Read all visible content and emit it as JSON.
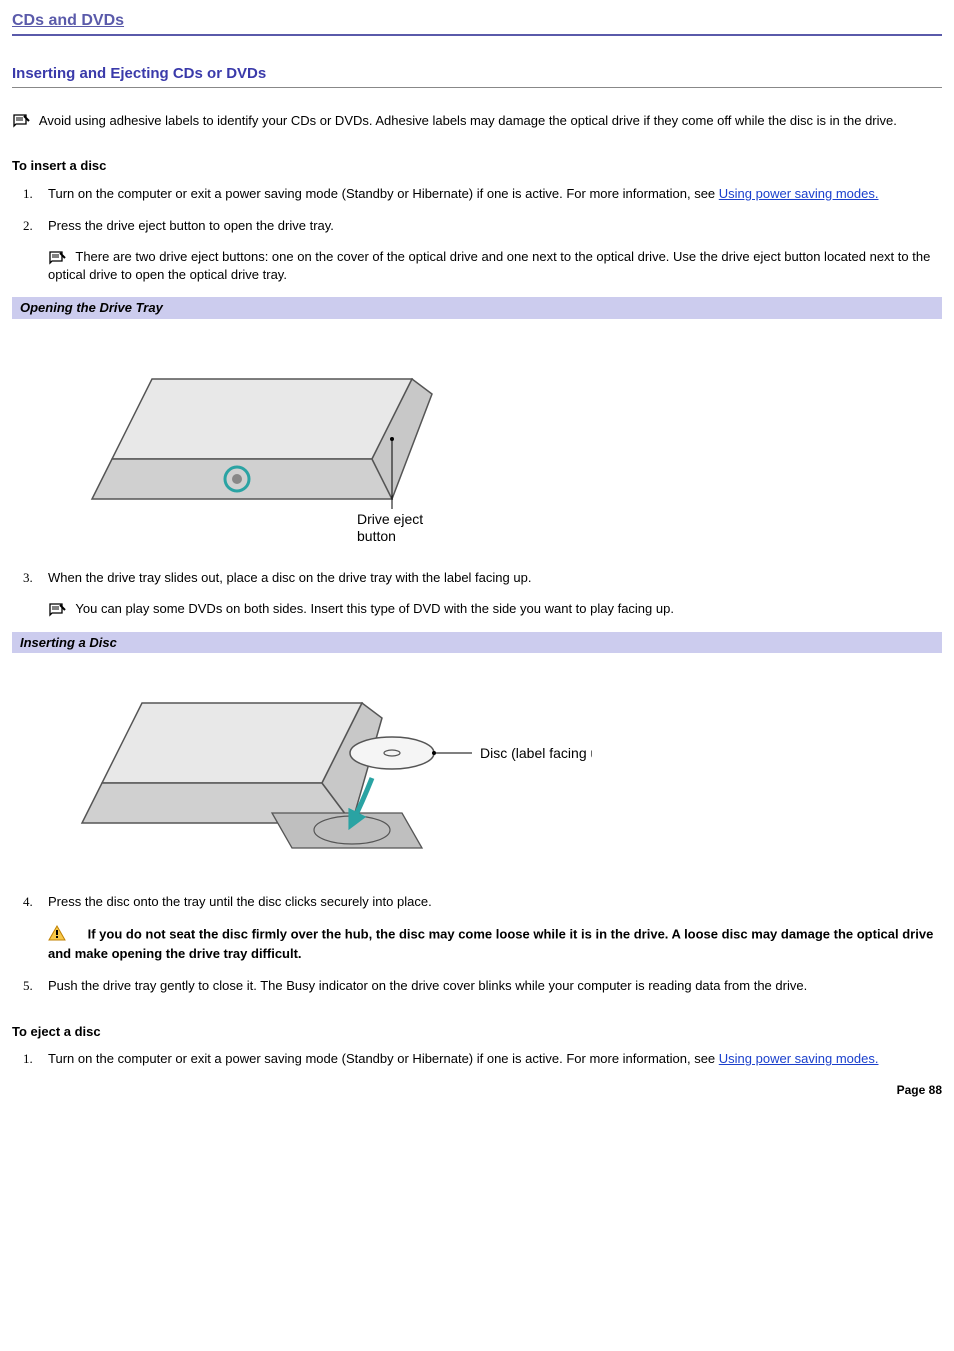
{
  "page_title": "CDs and DVDs",
  "section_title": "Inserting and Ejecting CDs or DVDs",
  "intro_note": "Avoid using adhesive labels to identify your CDs or DVDs. Adhesive labels may damage the optical drive if they come off while the disc is in the drive.",
  "insert": {
    "heading": "To insert a disc",
    "step1_a": "Turn on the computer or exit a power saving mode (Standby or Hibernate) if one is active. For more information, see ",
    "step1_link": "Using power saving modes.",
    "step2": "Press the drive eject button to open the drive tray.",
    "step2_note": "There are two drive eject buttons: one on the cover of the optical drive and one next to the optical drive. Use the drive eject button located next to the optical drive to open the optical drive tray.",
    "caption1": "Opening the Drive Tray",
    "fig1_label": "Drive eject button",
    "step3": "When the drive tray slides out, place a disc on the drive tray with the label facing up.",
    "step3_note": "You can play some DVDs on both sides. Insert this type of DVD with the side you want to play facing up.",
    "caption2": "Inserting a Disc",
    "fig2_label": "Disc (label facing up)",
    "step4": "Press the disc onto the tray until the disc clicks securely into place.",
    "step4_warn": "If you do not seat the disc firmly over the hub, the disc may come loose while it is in the drive. A loose disc may damage the optical drive and make opening the drive tray difficult.",
    "step5": "Push the drive tray gently to close it. The Busy indicator on the drive cover blinks while your computer is reading data from the drive."
  },
  "eject": {
    "heading": "To eject a disc",
    "step1_a": "Turn on the computer or exit a power saving mode (Standby or Hibernate) if one is active. For more information, see ",
    "step1_link": "Using power saving modes."
  },
  "page_number": "Page 88"
}
